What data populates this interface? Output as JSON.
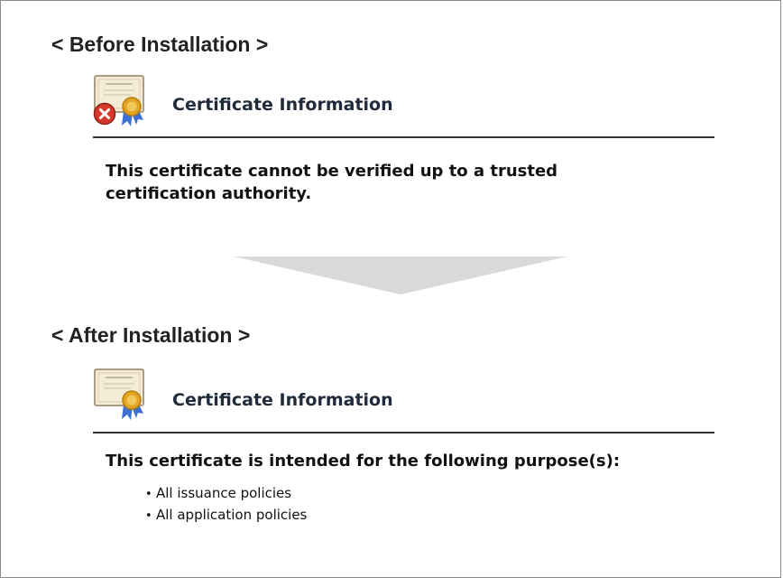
{
  "before": {
    "title": "< Before Installation >",
    "heading": "Certificate Information",
    "icon": "certificate-error-icon",
    "message": "This certificate cannot be verified up to a trusted certification authority."
  },
  "after": {
    "title": "< After Installation >",
    "heading": "Certificate Information",
    "icon": "certificate-icon",
    "message": "This certificate is intended for the following purpose(s):",
    "purposes": [
      "All issuance policies",
      "All application policies"
    ]
  },
  "colors": {
    "arrow": "#d9d9d9",
    "seal": "#e2a521",
    "ribbon": "#3b6fd1",
    "error": "#d33a2c"
  }
}
